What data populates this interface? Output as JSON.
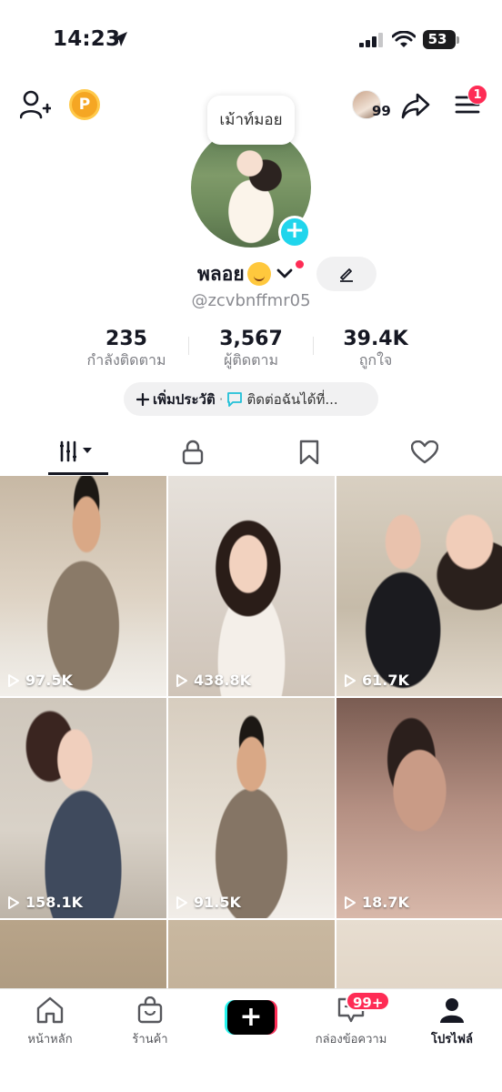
{
  "status_bar": {
    "time": "14:23",
    "battery": "53"
  },
  "header": {
    "points_label": "P",
    "viewer_count": "99",
    "menu_badge": "1",
    "note": "เม้าท์มอย"
  },
  "profile": {
    "display_name": "พลอย",
    "username": "@zcvbnffmr05",
    "stats": [
      {
        "value": "235",
        "label": "กำลังติดตาม"
      },
      {
        "value": "3,567",
        "label": "ผู้ติดตาม"
      },
      {
        "value": "39.4K",
        "label": "ถูกใจ"
      }
    ],
    "bio": {
      "add_label": "เพิ่มประวัติ",
      "separator": "·",
      "contact_label": "ติดต่อฉันได้ที่..."
    }
  },
  "tabs": [
    "videos-icon",
    "lock-icon",
    "bookmark-icon",
    "heart-icon"
  ],
  "videos": [
    {
      "views": "97.5K"
    },
    {
      "views": "438.8K"
    },
    {
      "views": "61.7K"
    },
    {
      "views": "158.1K"
    },
    {
      "views": "91.5K"
    },
    {
      "views": "18.7K"
    }
  ],
  "bottom_nav": {
    "home": "หน้าหลัก",
    "shop": "ร้านค้า",
    "inbox": "กล่องข้อความ",
    "inbox_badge": "99+",
    "profile": "โปรไฟล์"
  },
  "colors": {
    "accent_red": "#fe2c55",
    "accent_cyan": "#20d5ec",
    "text": "#161823"
  }
}
